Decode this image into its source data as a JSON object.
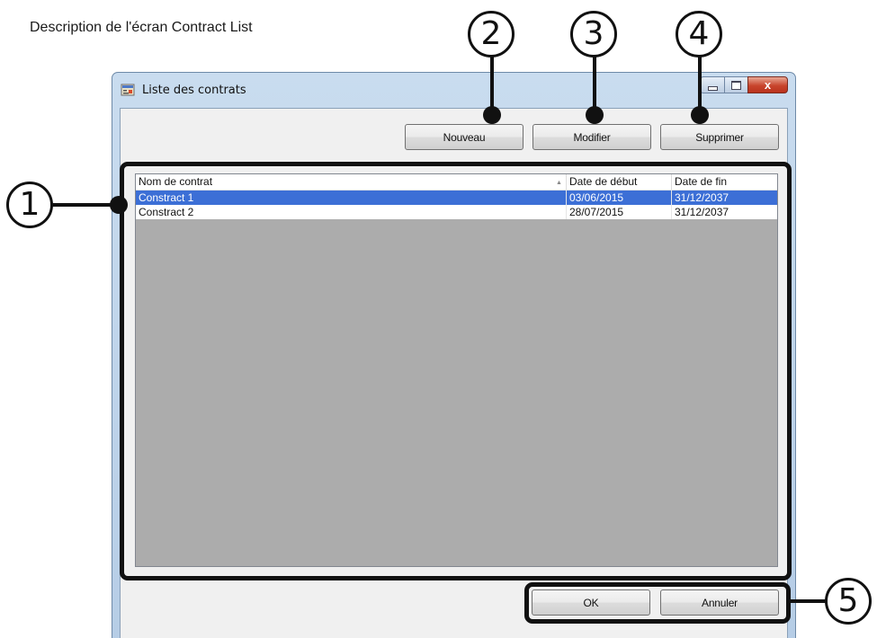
{
  "caption": "Description de l'écran Contract List",
  "window": {
    "title": "Liste des contrats",
    "close_glyph": "x"
  },
  "toolbar": {
    "new_label": "Nouveau",
    "edit_label": "Modifier",
    "delete_label": "Supprimer"
  },
  "list": {
    "columns": [
      "Nom de contrat",
      "Date de début",
      "Date de fin"
    ],
    "sort_glyph": "▲",
    "rows": [
      {
        "name": "Constract 1",
        "start": "03/06/2015",
        "end": "31/12/2037"
      },
      {
        "name": "Constract 2",
        "start": "28/07/2015",
        "end": "31/12/2037"
      }
    ]
  },
  "footer": {
    "ok_label": "OK",
    "cancel_label": "Annuler"
  },
  "callouts": [
    "1",
    "2",
    "3",
    "4",
    "5"
  ],
  "colors": {
    "selection": "#3c6fd6",
    "list_background": "#acacac",
    "close_button": "#c8452d"
  }
}
